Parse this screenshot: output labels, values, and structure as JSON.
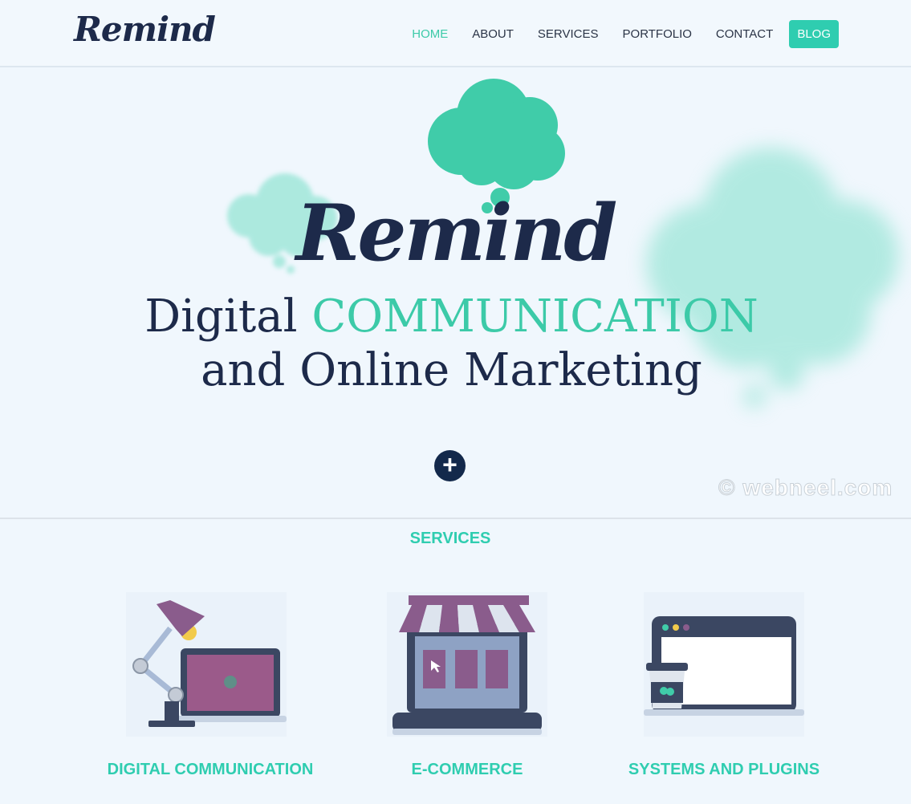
{
  "header": {
    "logo": "Remind",
    "nav": [
      "HOME",
      "ABOUT",
      "SERVICES",
      "PORTFOLIO",
      "CONTACT"
    ],
    "blog": "BLOG",
    "active_item": "HOME"
  },
  "hero": {
    "logo": "Remind",
    "line1_a": "Digital ",
    "line1_b": "COMMUNICATION",
    "line2": "and Online Marketing",
    "plus_symbol": "+"
  },
  "watermark": "© webneel.com",
  "services": {
    "title": "SERVICES",
    "items": [
      {
        "label": "DIGITAL COMMUNICATION",
        "icon": "desk-lamp-laptop-icon"
      },
      {
        "label": "E-COMMERCE",
        "icon": "shop-laptop-icon"
      },
      {
        "label": "SYSTEMS AND PLUGINS",
        "icon": "browser-coffee-icon"
      }
    ]
  },
  "colors": {
    "accent": "#3ccaa8",
    "navy": "#1d2a4a",
    "background": "#f0f7fd",
    "purple": "#8a5c8c"
  }
}
